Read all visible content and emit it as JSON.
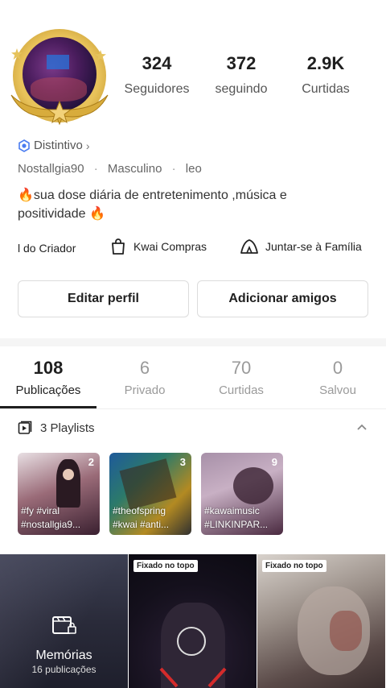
{
  "profile": {
    "stats": [
      {
        "value": "324",
        "label": "Seguidores"
      },
      {
        "value": "372",
        "label": "seguindo"
      },
      {
        "value": "2.9K",
        "label": "Curtidas"
      }
    ],
    "badge_label": "Distintivo",
    "username": "Nostallgia90",
    "gender": "Masculino",
    "location": "leo",
    "bio_line1": "sua dose diária de entretenimento ,música e",
    "bio_line2": "positividade",
    "bio_emoji": "🔥"
  },
  "links": {
    "creator": "l do Criador",
    "shopping": "Kwai Compras",
    "family": "Juntar-se à Família"
  },
  "buttons": {
    "edit": "Editar perfil",
    "add_friends": "Adicionar amigos"
  },
  "tabs": [
    {
      "count": "108",
      "label": "Publicações"
    },
    {
      "count": "6",
      "label": "Privado"
    },
    {
      "count": "70",
      "label": "Curtidas"
    },
    {
      "count": "0",
      "label": "Salvou"
    }
  ],
  "playlists": {
    "header": "3 Playlists",
    "items": [
      {
        "count": "2",
        "tag1": "#fy #viral",
        "tag2": "#nostallgia9..."
      },
      {
        "count": "3",
        "tag1": "#theofspring",
        "tag2": "#kwai #anti..."
      },
      {
        "count": "9",
        "tag1": "#kawaimusic",
        "tag2": "#LINKINPAR..."
      }
    ]
  },
  "grid": {
    "memories_title": "Memórias",
    "memories_sub": "16 publicações",
    "pinned_label": "Fixado no topo"
  },
  "colors": {
    "badge_blue": "#4a7cf0",
    "text_dark": "#1f1f1f",
    "text_muted": "#9a9a9a"
  }
}
